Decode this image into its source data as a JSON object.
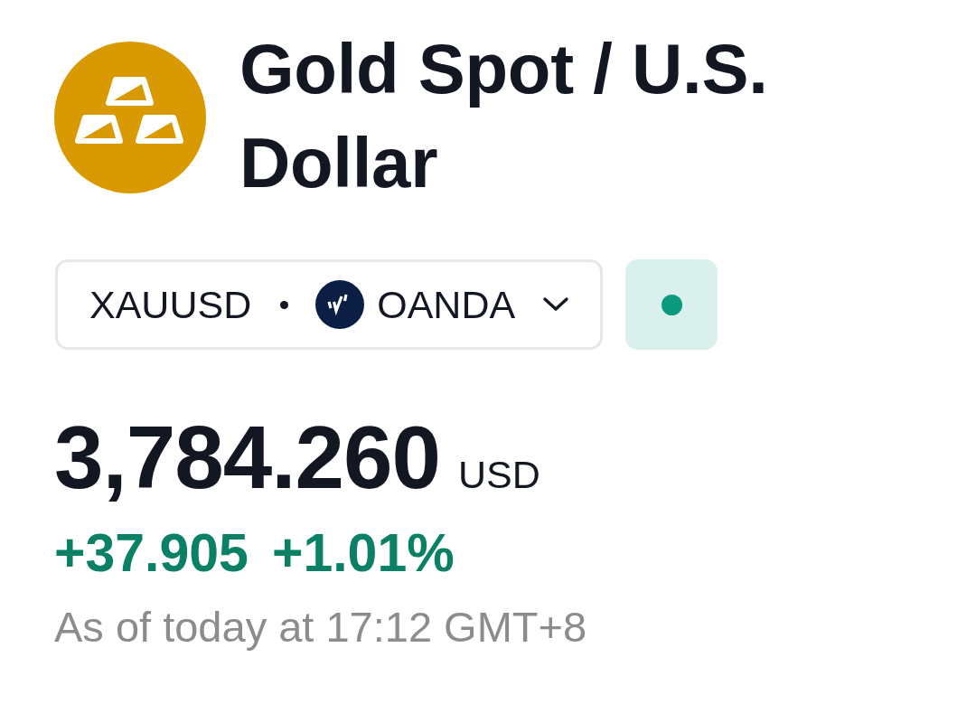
{
  "header": {
    "title": "Gold Spot / U.S. Dollar"
  },
  "symbol_selector": {
    "symbol": "XAUUSD",
    "exchange": "OANDA",
    "expanded": false
  },
  "market_status": {
    "open": true
  },
  "quote": {
    "price": "3,784.260",
    "currency": "USD",
    "positive": true,
    "change": "+37.905",
    "change_percent": "+1.01%",
    "timestamp": "As of today at 17:12 GMT+8"
  }
}
